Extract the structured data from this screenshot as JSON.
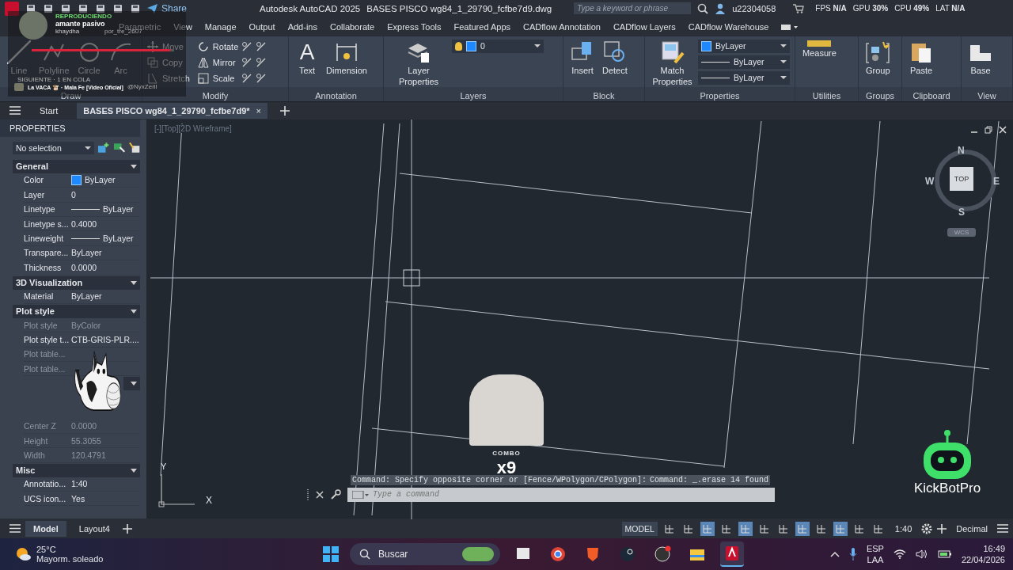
{
  "title_bar": {
    "share": "Share",
    "title": "Autodesk AutoCAD 2025",
    "file": "BASES PISCO wg84_1_29790_fcfbe7d9.dwg",
    "search": {
      "placeholder": "Type a keyword or phrase"
    },
    "user": "u22304058",
    "stats": [
      {
        "label": "FPS",
        "value": "N/A"
      },
      {
        "label": "GPU",
        "value": "30%"
      },
      {
        "label": "CPU",
        "value": "49%"
      },
      {
        "label": "LAT",
        "value": "N/A"
      }
    ]
  },
  "ribbon_tabs": [
    "Parametric",
    "View",
    "Manage",
    "Output",
    "Add-ins",
    "Collaborate",
    "Express Tools",
    "Featured Apps",
    "CADflow Annotation",
    "CADflow Layers",
    "CADflow Warehouse"
  ],
  "ribbon_panels": [
    {
      "title": "Draw",
      "large": [
        {
          "label": "Line"
        },
        {
          "label": "Polyline"
        },
        {
          "label": "Circle"
        },
        {
          "label": "Arc"
        }
      ]
    },
    {
      "title": "Modify",
      "small": [
        {
          "label": "Move"
        },
        {
          "label": "Copy"
        },
        {
          "label": "Stretch"
        },
        {
          "label": "Rotate"
        },
        {
          "label": "Mirror"
        },
        {
          "label": "Scale"
        }
      ]
    },
    {
      "title": "Annotation",
      "large": [
        {
          "label": "Text",
          "glyph": "A"
        },
        {
          "label": "Dimension"
        }
      ]
    },
    {
      "title": "Layers",
      "large": [
        {
          "label": "Layer Properties"
        }
      ],
      "dropdowns": [
        {
          "value": "0",
          "kind": "layer"
        }
      ]
    },
    {
      "title": "Block",
      "large": [
        {
          "label": "Insert"
        },
        {
          "label": "Detect"
        }
      ]
    },
    {
      "title": "Properties",
      "large": [
        {
          "label": "Match Properties"
        }
      ],
      "dropdowns": [
        {
          "value": "ByLayer",
          "kind": "color"
        },
        {
          "value": "ByLayer",
          "kind": "line"
        },
        {
          "value": "ByLayer",
          "kind": "line"
        }
      ]
    },
    {
      "title": "Utilities",
      "large": [
        {
          "label": "Measure"
        }
      ]
    },
    {
      "title": "Groups",
      "large": [
        {
          "label": "Group"
        }
      ]
    },
    {
      "title": "Clipboard",
      "large": [
        {
          "label": "Paste"
        }
      ]
    },
    {
      "title": "View",
      "large": [
        {
          "label": "Base"
        }
      ]
    }
  ],
  "document_tabs": [
    {
      "label": "Start",
      "selected": false
    },
    {
      "label": "BASES PISCO wg84_1_29790_fcfbe7d9*",
      "selected": true,
      "close": "×"
    }
  ],
  "properties": {
    "title": "PROPERTIES",
    "selection": "No selection",
    "sections": [
      {
        "title": "General",
        "rows": [
          {
            "name": "Color",
            "value": "ByLayer",
            "kind": "swatch",
            "disabled": false
          },
          {
            "name": "Layer",
            "value": "0",
            "kind": "text",
            "disabled": false
          },
          {
            "name": "Linetype",
            "value": "ByLayer",
            "kind": "line",
            "disabled": false
          },
          {
            "name": "Linetype s...",
            "value": "0.4000",
            "kind": "text",
            "disabled": false
          },
          {
            "name": "Lineweight",
            "value": "ByLayer",
            "kind": "line",
            "disabled": false
          },
          {
            "name": "Transpare...",
            "value": "ByLayer",
            "kind": "text",
            "disabled": false
          },
          {
            "name": "Thickness",
            "value": "0.0000",
            "kind": "text",
            "disabled": false
          }
        ]
      },
      {
        "title": "3D Visualization",
        "rows": [
          {
            "name": "Material",
            "value": "ByLayer",
            "kind": "text",
            "disabled": false
          }
        ]
      },
      {
        "title": "Plot style",
        "rows": [
          {
            "name": "Plot style",
            "value": "ByColor",
            "kind": "text",
            "disabled": true
          },
          {
            "name": "Plot style t...",
            "value": "CTB-GRIS-PLR....",
            "kind": "text",
            "disabled": false
          },
          {
            "name": "Plot table...",
            "kind": "text",
            "disabled": true
          },
          {
            "name": "Plot table...",
            "kind": "text",
            "disabled": true
          }
        ]
      },
      {
        "rows": [
          {
            "name": "Center Z",
            "value": "0.0000",
            "kind": "text",
            "disabled": true
          },
          {
            "name": "Height",
            "value": "55.3055",
            "kind": "text",
            "disabled": true
          },
          {
            "name": "Width",
            "value": "120.4791",
            "kind": "text",
            "disabled": true
          }
        ]
      },
      {
        "title": "Misc",
        "rows": [
          {
            "name": "Annotatio...",
            "value": "1:40",
            "kind": "text",
            "disabled": false
          },
          {
            "name": "UCS icon...",
            "value": "Yes",
            "kind": "text",
            "disabled": false
          }
        ]
      }
    ]
  },
  "viewport": {
    "label": "[-][Top][2D Wireframe]",
    "viewcube": {
      "north": "N",
      "south": "S",
      "east": "E",
      "west": "W",
      "face": "TOP",
      "ucs": "WCS"
    },
    "ucs_axes": {
      "x": "X",
      "y": "Y"
    }
  },
  "command_line": {
    "history": [
      "Command: Specify opposite corner or [Fence/WPolygon/CPolygon]:",
      "Command: _.erase 14 found"
    ],
    "placeholder": "Type a command"
  },
  "layout_tabs": [
    {
      "label": "Model",
      "selected": true
    },
    {
      "label": "Layout4",
      "selected": false
    }
  ],
  "status_bar": {
    "space": "MODEL",
    "toggles": [
      {
        "on": false
      },
      {
        "on": false
      },
      {
        "on": true
      },
      {
        "on": false
      },
      {
        "on": true
      },
      {
        "on": false
      },
      {
        "on": false
      },
      {
        "on": true
      },
      {
        "on": false
      },
      {
        "on": true
      },
      {
        "on": false
      },
      {
        "on": false
      }
    ],
    "scale": "1:40",
    "units": "Decimal"
  },
  "taskbar": {
    "weather": {
      "temperature": "25°C",
      "condition": "Mayorm. soleado"
    },
    "search": {
      "placeholder": "Buscar"
    },
    "apps": [
      {
        "selected": false
      },
      {
        "selected": false
      },
      {
        "selected": false
      },
      {
        "selected": false
      },
      {
        "selected": false
      },
      {
        "selected": false
      },
      {
        "selected": true
      }
    ],
    "language": "ESP",
    "layout": "LAA",
    "time": "16:49",
    "date": "22/04/2026"
  },
  "stream_overlay": {
    "now_playing": {
      "status": "REPRODUCIENDO",
      "song": "amante pasivo",
      "artist": "khaydha",
      "requested_by": "por_tre_2607",
      "level": 0.97,
      "queue": "SIGUIENTE · 1 EN COLA",
      "next_song": "La VACA 🐮 · Mala Fe [Video Oficial]",
      "next_by": "@NyxZeril"
    },
    "combo": {
      "label": "COMBO",
      "count": "x9"
    },
    "bot": "KickBotPro"
  }
}
